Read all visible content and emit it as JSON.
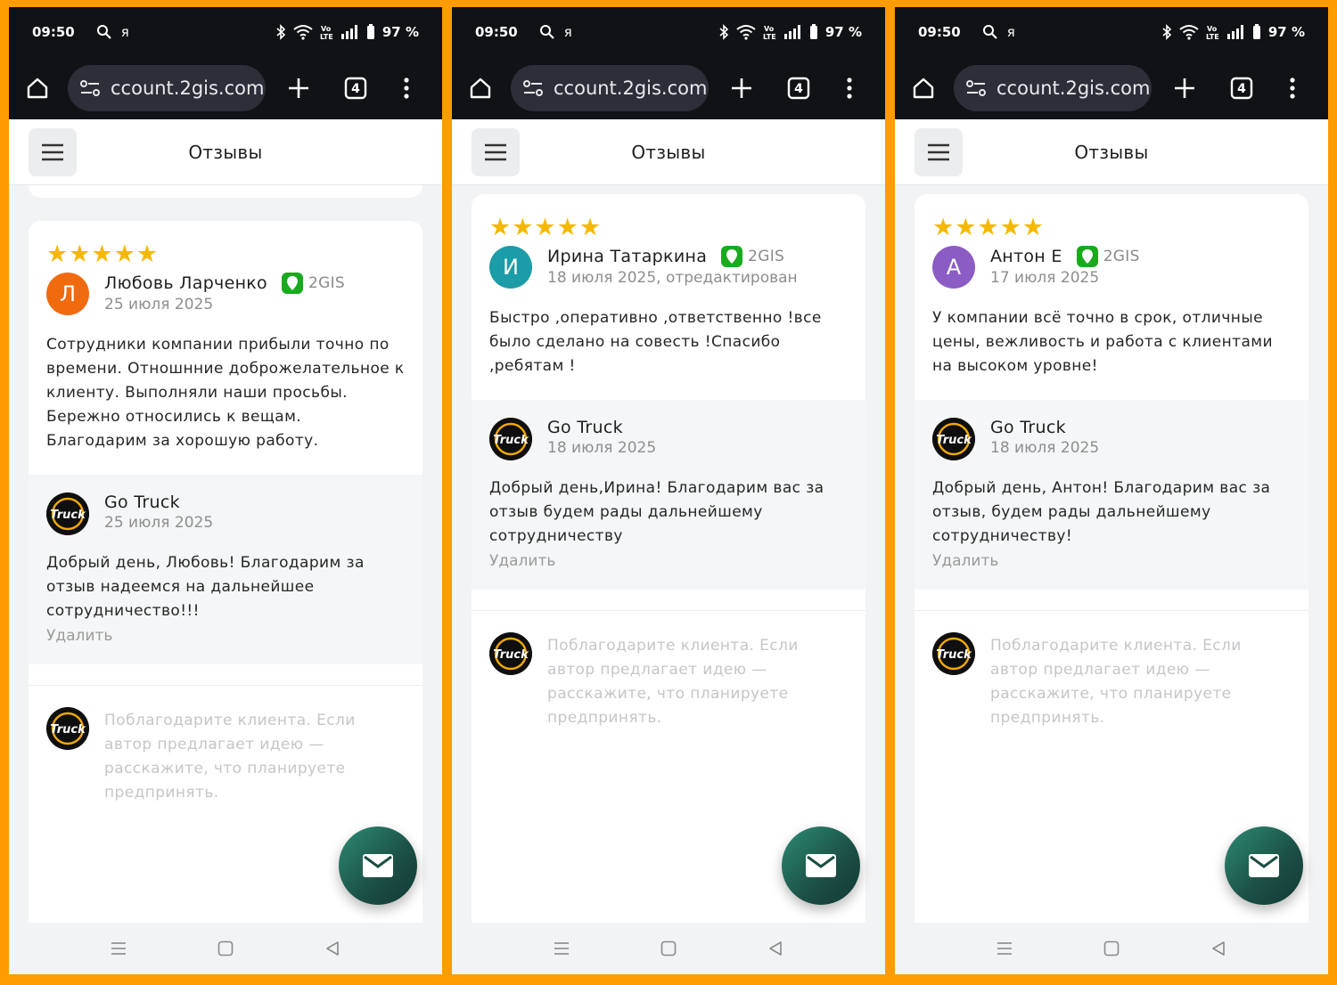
{
  "status": {
    "time": "09:50",
    "carrier": "я",
    "battery": "97 %"
  },
  "browser": {
    "url": "ccount.2gis.com",
    "tab_count": "4"
  },
  "appbar": {
    "title": "Отзывы"
  },
  "brand": {
    "name": "Go Truck",
    "logo_text": "Truck"
  },
  "source_badge": "2GIS",
  "stars": "★★★★★",
  "delete_label": "Удалить",
  "reply_placeholder": "Поблагодарите клиента. Если автор предлагает идею — расскажите, что планируете предпринять.",
  "colors": {
    "frame": "#FF9C00",
    "star": "#F5B800",
    "gis_green": "#19AA1E",
    "fab": "#1B4E44"
  },
  "panels": [
    {
      "review": {
        "initial": "Л",
        "avatar_color": "#F26A0E",
        "author": "Любовь Ларченко",
        "date": "25 июля 2025",
        "text": "Сотрудники компании прибыли точно по времени. Отношнние доброжелательное к клиенту. Выполняли наши просьбы. Бережно относились к вещам. Благодарим за хорошую работу."
      },
      "reply": {
        "date": "25 июля 2025",
        "text": "Добрый день, Любовь! Благодарим за отзыв надеемся на дальнейшее сотрудничество!!!"
      }
    },
    {
      "review": {
        "initial": "И",
        "avatar_color": "#1C9CA6",
        "author": "Ирина Татаркина",
        "date": "18 июля 2025, отредактирован",
        "text": "Быстро ,оперативно ,ответственно !все было сделано на совесть !Спасибо ,ребятам !"
      },
      "reply": {
        "date": "18 июля 2025",
        "text": "Добрый день,Ирина! Благодарим вас за отзыв будем рады дальнейшему сотрудничеству"
      }
    },
    {
      "review": {
        "initial": "А",
        "avatar_color": "#8B5CC4",
        "author": "Антон Е",
        "date": "17 июля 2025",
        "text": "У компании всё точно в срок, отличные цены, вежливость и работа с клиентами на высоком уровне!"
      },
      "reply": {
        "date": "18 июля 2025",
        "text": "Добрый день, Антон! Благодарим вас за отзыв, будем рады дальнейшему сотрудничеству!"
      }
    }
  ]
}
